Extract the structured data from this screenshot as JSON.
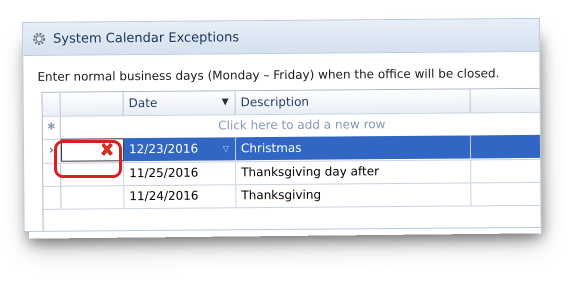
{
  "window": {
    "title": "System Calendar Exceptions",
    "icon": "gear-icon"
  },
  "instructions": "Enter normal business days (Monday – Friday) when the office will be closed.",
  "grid": {
    "columns": [
      "",
      "Date",
      "Description"
    ],
    "add_row_text": "Click here to add a new row",
    "rows": [
      {
        "date": "12/23/2016",
        "description": "Christmas",
        "selected": true
      },
      {
        "date": "11/25/2016",
        "description": "Thanksgiving day after",
        "selected": false
      },
      {
        "date": "11/24/2016",
        "description": "Thanksgiving",
        "selected": false
      }
    ]
  },
  "colors": {
    "selection": "#3166c4",
    "callout": "#d92020",
    "delete": "#e0301e"
  }
}
